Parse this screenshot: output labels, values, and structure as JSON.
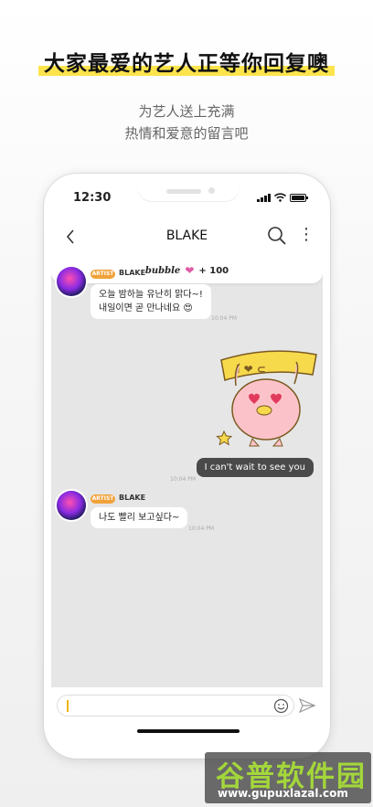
{
  "headline": "大家最爱的艺人正等你回复噢",
  "subtitle": [
    "为艺人送上充满",
    "热情和爱意的留言吧"
  ],
  "statusbar": {
    "time": "12:30"
  },
  "header": {
    "title": "BLAKE"
  },
  "bubble_bar": {
    "word": "bubble",
    "count": "+ 100"
  },
  "messages": [
    {
      "badge": "ARTIST",
      "sender": "BLAKE",
      "lines": [
        "오늘 밤하늘 유난히 맑다~!",
        "내일이면 곧 만나네요 😍"
      ],
      "time": "10:04 PM"
    },
    {
      "text": "I can't wait to see you",
      "time": "10:04 PM"
    },
    {
      "badge": "ARTIST",
      "sender": "BLAKE",
      "lines": [
        "나도 빨리 보고싶다~"
      ],
      "time": "10:04 PM"
    }
  ],
  "sticker": {
    "sign_text": "I ❤ ⊂"
  },
  "input": {
    "placeholder": ""
  },
  "watermark": {
    "title": "谷普软件园",
    "url": "www.gupuxlazal.com"
  },
  "colors": {
    "highlight": "#fde44c",
    "badge": "#f0a23a",
    "outgoing": "#4a4a4a",
    "caret": "#f0b400",
    "heart": "#e05aa6"
  }
}
